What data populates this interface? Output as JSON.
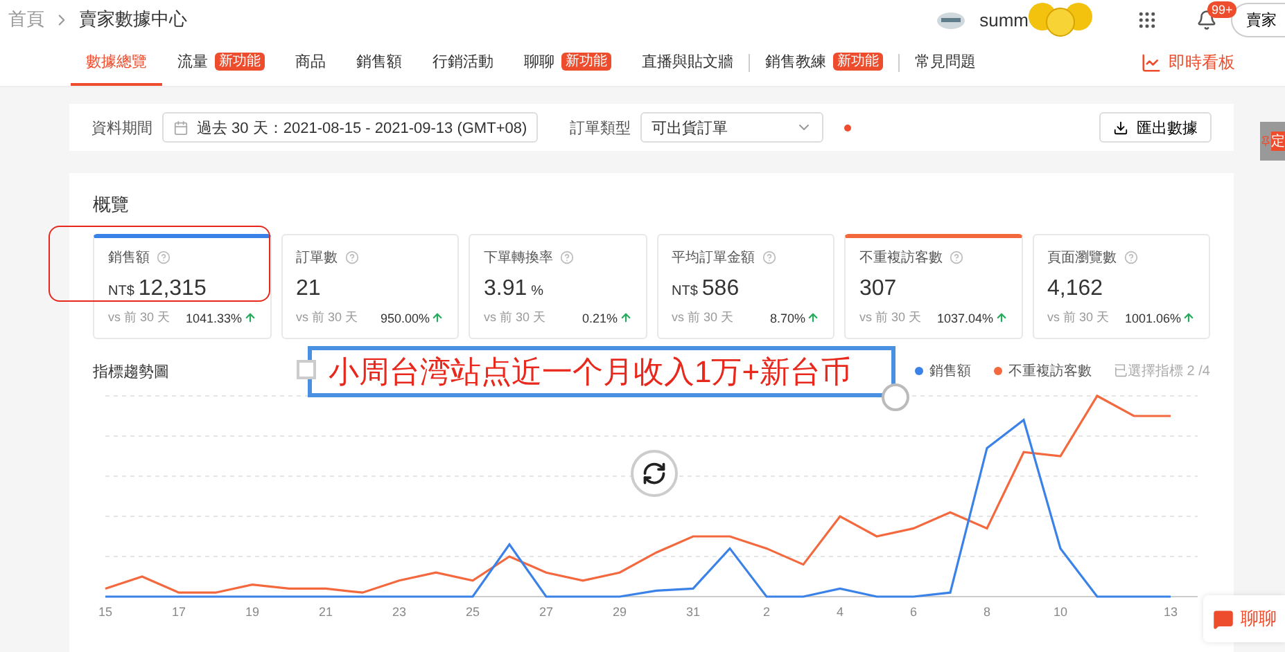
{
  "breadcrumb": {
    "home": "首頁",
    "current": "賣家數據中心"
  },
  "header": {
    "user": "summ",
    "notifications_badge": "99+",
    "account_button": "賣家"
  },
  "nav": {
    "tabs": [
      {
        "label": "數據總覽",
        "selected": true,
        "divider_before": false
      },
      {
        "label": "流量",
        "badge": "新功能",
        "selected": false,
        "divider_before": false
      },
      {
        "label": "商品",
        "selected": false,
        "divider_before": false
      },
      {
        "label": "銷售額",
        "selected": false,
        "divider_before": false
      },
      {
        "label": "行銷活動",
        "selected": false,
        "divider_before": false
      },
      {
        "label": "聊聊",
        "badge": "新功能",
        "selected": false,
        "divider_before": false
      },
      {
        "label": "直播與貼文牆",
        "selected": false,
        "divider_before": false
      },
      {
        "label": "銷售教練",
        "badge": "新功能",
        "selected": false,
        "divider_before": true
      },
      {
        "label": "常見問題",
        "selected": false,
        "divider_before": true
      }
    ],
    "live_board": "即時看板"
  },
  "filters": {
    "period_label": "資料期間",
    "period_value": "過去 30 天：2021-08-15 - 2021-09-13 (GMT+08)",
    "order_type_label": "訂單類型",
    "order_type_value": "可出貨訂單",
    "export_button": "匯出數據"
  },
  "side_tab": "定",
  "overview": {
    "title": "概覽",
    "metrics": [
      {
        "label": "銷售額",
        "prefix": "NT$",
        "value": "12,315",
        "compare": "vs 前 30 天",
        "change": "1041.33%",
        "selected": true,
        "color": "#3b82e8"
      },
      {
        "label": "訂單數",
        "value": "21",
        "compare": "vs 前 30 天",
        "change": "950.00%",
        "selected": false
      },
      {
        "label": "下單轉換率",
        "value": "3.91",
        "suffix": "%",
        "compare": "vs 前 30 天",
        "change": "0.21%",
        "selected": false
      },
      {
        "label": "平均訂單金額",
        "prefix": "NT$",
        "value": "586",
        "compare": "vs 前 30 天",
        "change": "8.70%",
        "selected": false
      },
      {
        "label": "不重複訪客數",
        "value": "307",
        "compare": "vs 前 30 天",
        "change": "1037.04%",
        "selected": true,
        "color": "#f4683e"
      },
      {
        "label": "頁面瀏覽數",
        "value": "4,162",
        "compare": "vs 前 30 天",
        "change": "1001.06%",
        "selected": false
      }
    ]
  },
  "chart": {
    "title": "指標趨勢圖",
    "legend": [
      {
        "label": "銷售額",
        "color": "#3b82e8"
      },
      {
        "label": "不重複訪客數",
        "color": "#f4683e"
      }
    ],
    "selected_count": "已選擇指標 2 /4",
    "x_labels": [
      "15",
      "17",
      "19",
      "21",
      "23",
      "25",
      "27",
      "29",
      "31",
      "2",
      "4",
      "6",
      "8",
      "10",
      "13"
    ]
  },
  "annotation": {
    "caption": "小周台湾站点近一个月收入1万+新台币"
  },
  "chat_button": "聊聊"
}
